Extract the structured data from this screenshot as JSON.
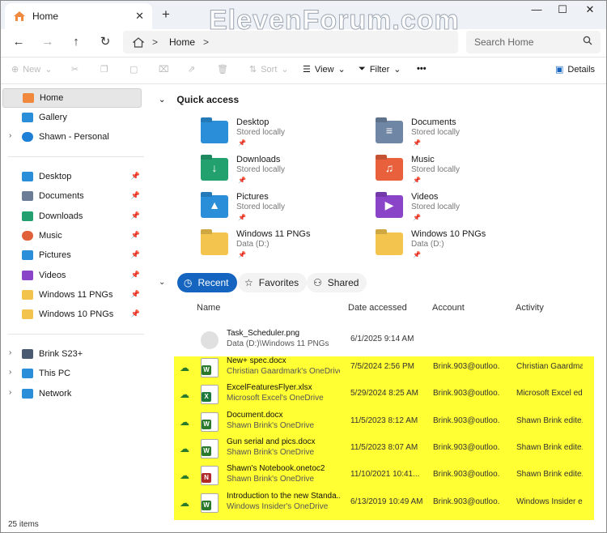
{
  "window": {
    "tab_title": "Home",
    "close_tab": "✕",
    "new_tab": "+",
    "min": "—",
    "max": "☐",
    "close": "✕",
    "watermark": "ElevenForum.com"
  },
  "address": {
    "back": "←",
    "forward": "→",
    "up": "↑",
    "refresh": "↻",
    "crumb": "Home",
    "sep": ">",
    "search_placeholder": "Search Home"
  },
  "toolbar": {
    "new": "New",
    "sort": "Sort",
    "view": "View",
    "filter": "Filter",
    "more": "•••",
    "details": "Details"
  },
  "nav": {
    "top": [
      {
        "label": "Home",
        "selected": true,
        "color": "#f0883e"
      },
      {
        "label": "Gallery",
        "color": "#2a8fd8"
      },
      {
        "label": "Shawn - Personal",
        "color": "#1e7fd6",
        "expandable": true
      }
    ],
    "pinned": [
      {
        "label": "Desktop",
        "color": "#2a8fd8"
      },
      {
        "label": "Documents",
        "color": "#6b7d96"
      },
      {
        "label": "Downloads",
        "color": "#24a070"
      },
      {
        "label": "Music",
        "color": "#e0603a"
      },
      {
        "label": "Pictures",
        "color": "#2a8fd8"
      },
      {
        "label": "Videos",
        "color": "#8a44c8"
      },
      {
        "label": "Windows 11 PNGs",
        "color": "#f2c44e"
      },
      {
        "label": "Windows 10 PNGs",
        "color": "#f2c44e"
      }
    ],
    "devices": [
      {
        "label": "Brink S23+",
        "color": "#4a5a70"
      },
      {
        "label": "This PC",
        "color": "#2a8fd8"
      },
      {
        "label": "Network",
        "color": "#2a8fd8"
      }
    ]
  },
  "quick_access": {
    "title": "Quick access",
    "items": [
      {
        "name": "Desktop",
        "sub": "Stored locally",
        "color": "#2a8fd8",
        "glyph": ""
      },
      {
        "name": "Documents",
        "sub": "Stored locally",
        "color": "#7086a5",
        "glyph": "≡"
      },
      {
        "name": "Downloads",
        "sub": "Stored locally",
        "color": "#22a06e",
        "glyph": "↓"
      },
      {
        "name": "Music",
        "sub": "Stored locally",
        "color": "#e8603c",
        "glyph": "♫"
      },
      {
        "name": "Pictures",
        "sub": "Stored locally",
        "color": "#2a8fd8",
        "glyph": "▲"
      },
      {
        "name": "Videos",
        "sub": "Stored locally",
        "color": "#8a44c8",
        "glyph": "▶"
      },
      {
        "name": "Windows 11 PNGs",
        "sub": "Data (D:)",
        "color": "#f3c54f",
        "glyph": ""
      },
      {
        "name": "Windows 10 PNGs",
        "sub": "Data (D:)",
        "color": "#f3c54f",
        "glyph": ""
      }
    ]
  },
  "tabs": {
    "recent": "Recent",
    "favorites": "Favorites",
    "shared": "Shared"
  },
  "columns": {
    "name": "Name",
    "date": "Date accessed",
    "account": "Account",
    "activity": "Activity"
  },
  "files": [
    {
      "name": "Task_Scheduler.png",
      "loc": "Data (D:)\\Windows 11 PNGs",
      "date": "6/1/2025 9:14 AM",
      "account": "",
      "activity": "",
      "type": "png",
      "cloud": false
    },
    {
      "name": "New+ spec.docx",
      "loc": "Christian Gaardmark's OneDrive",
      "date": "7/5/2024 2:56 PM",
      "account": "Brink.903@outloo...",
      "activity": "Christian Gaardma...",
      "type": "W",
      "cloud": true
    },
    {
      "name": "ExcelFeaturesFlyer.xlsx",
      "loc": "Microsoft Excel's OneDrive",
      "date": "5/29/2024 8:25 AM",
      "account": "Brink.903@outloo...",
      "activity": "Microsoft Excel edi...",
      "type": "X",
      "cloud": true
    },
    {
      "name": "Document.docx",
      "loc": "Shawn Brink's OneDrive",
      "date": "11/5/2023 8:12 AM",
      "account": "Brink.903@outloo...",
      "activity": "Shawn Brink edite...",
      "type": "W",
      "cloud": true
    },
    {
      "name": "Gun serial and pics.docx",
      "loc": "Shawn Brink's OneDrive",
      "date": "11/5/2023 8:07 AM",
      "account": "Brink.903@outloo...",
      "activity": "Shawn Brink edite...",
      "type": "W",
      "cloud": true
    },
    {
      "name": "Shawn's Notebook.onetoc2",
      "loc": "Shawn Brink's OneDrive",
      "date": "11/10/2021 10:41...",
      "account": "Brink.903@outloo...",
      "activity": "Shawn Brink edite...",
      "type": "N",
      "cloud": true
    },
    {
      "name": "Introduction to the new Standa...",
      "loc": "Windows Insider's OneDrive",
      "date": "6/13/2019 10:49 AM",
      "account": "Brink.903@outloo...",
      "activity": "Windows Insider e...",
      "type": "W",
      "cloud": true
    }
  ],
  "status": {
    "count": "25 items"
  },
  "colors": {
    "accent": "#1565c0",
    "highlight": "#ffff33"
  }
}
